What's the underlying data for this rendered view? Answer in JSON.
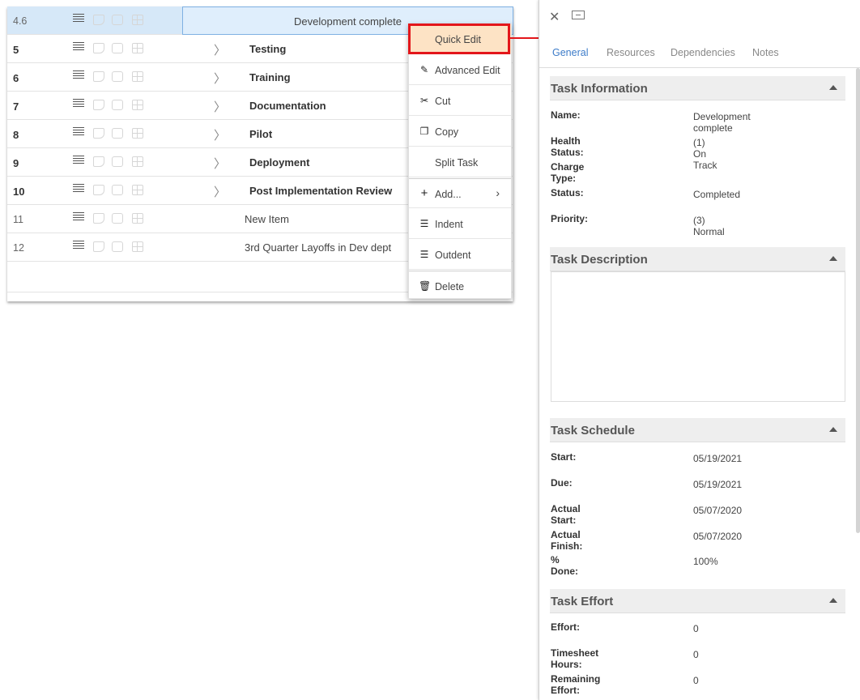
{
  "grid": {
    "rows": [
      {
        "num": "4.6",
        "name": "Development complete",
        "selected": true,
        "summary": false
      },
      {
        "num": "5",
        "name": "Testing",
        "summary": true
      },
      {
        "num": "6",
        "name": "Training",
        "summary": true
      },
      {
        "num": "7",
        "name": "Documentation",
        "summary": true
      },
      {
        "num": "8",
        "name": "Pilot",
        "summary": true
      },
      {
        "num": "9",
        "name": "Deployment",
        "summary": true
      },
      {
        "num": "10",
        "name": "Post Implementation Review",
        "summary": true
      },
      {
        "num": "11",
        "name": "New Item",
        "summary": false
      },
      {
        "num": "12",
        "name": "3rd Quarter Layoffs in Dev dept",
        "summary": false
      }
    ]
  },
  "context_menu": {
    "items": [
      {
        "label": "Quick Edit",
        "icon": "",
        "highlight": true
      },
      {
        "label": "Advanced Edit",
        "icon": "pencil-icon"
      },
      {
        "label": "Cut",
        "icon": "scissors-icon"
      },
      {
        "label": "Copy",
        "icon": "copy-icon"
      },
      {
        "label": "Split Task",
        "icon": ""
      },
      {
        "label": "Add...",
        "icon": "plus-icon",
        "submenu": true
      },
      {
        "label": "Indent",
        "icon": "indent-icon"
      },
      {
        "label": "Outdent",
        "icon": "outdent-icon"
      },
      {
        "label": "Delete",
        "icon": "trash-icon"
      }
    ],
    "highlight_color": "#e3161a"
  },
  "panel": {
    "tabs": [
      "General",
      "Resources",
      "Dependencies",
      "Notes"
    ],
    "active_tab": "General",
    "sections": {
      "info": {
        "title": "Task Information",
        "fields": [
          {
            "label": "Name:",
            "value": "Development complete"
          },
          {
            "label": "Health Status:",
            "value": "(1) On Track"
          },
          {
            "label": "Charge Type:",
            "value": ""
          },
          {
            "label": "Status:",
            "value": "Completed"
          },
          {
            "label": "Priority:",
            "value": "(3) Normal"
          }
        ]
      },
      "description": {
        "title": "Task Description"
      },
      "schedule": {
        "title": "Task Schedule",
        "fields": [
          {
            "label": "Start:",
            "value": "05/19/2021"
          },
          {
            "label": "Due:",
            "value": "05/19/2021"
          },
          {
            "label": "Actual Start:",
            "value": "05/07/2020"
          },
          {
            "label": "Actual Finish:",
            "value": "05/07/2020"
          },
          {
            "label": "% Done:",
            "value": "100%"
          }
        ]
      },
      "effort": {
        "title": "Task Effort",
        "fields": [
          {
            "label": "Effort:",
            "value": "0"
          },
          {
            "label": "Timesheet Hours:",
            "value": "0"
          },
          {
            "label": "Remaining Effort:",
            "value": "0"
          }
        ]
      }
    }
  }
}
